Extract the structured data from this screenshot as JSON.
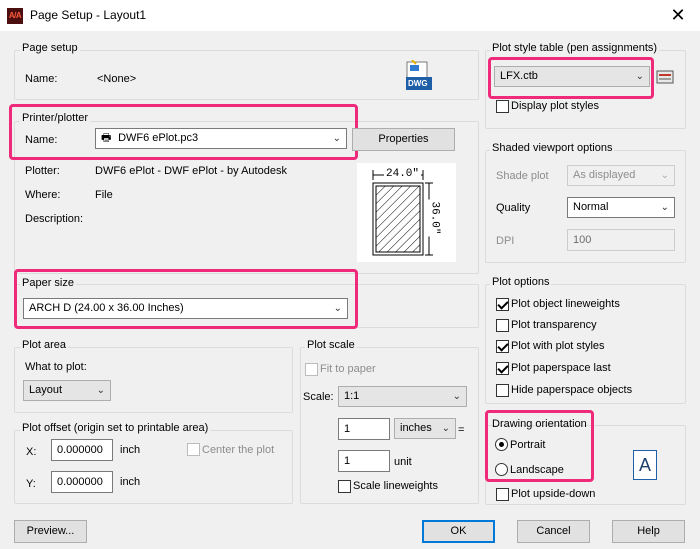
{
  "window": {
    "title": "Page Setup - Layout1",
    "app_icon": "A/A"
  },
  "page_setup": {
    "label": "Page setup",
    "name_label": "Name:",
    "name_value": "<None>",
    "dwg_icon_text": "DWG"
  },
  "printer": {
    "label": "Printer/plotter",
    "name_label": "Name:",
    "name_value": "DWF6 ePlot.pc3",
    "properties_button": "Properties",
    "plotter_label": "Plotter:",
    "plotter_value": "DWF6 ePlot - DWF ePlot - by Autodesk",
    "where_label": "Where:",
    "where_value": "File",
    "description_label": "Description:",
    "preview_width": "24.0″",
    "preview_height": "36.0″"
  },
  "paper_size": {
    "label": "Paper size",
    "value": "ARCH D (24.00 x 36.00 Inches)"
  },
  "plot_area": {
    "label": "Plot area",
    "what_label": "What to plot:",
    "value": "Layout"
  },
  "plot_offset": {
    "label": "Plot offset (origin set to printable area)",
    "x_label": "X:",
    "x_value": "0.000000",
    "x_unit": "inch",
    "y_label": "Y:",
    "y_value": "0.000000",
    "y_unit": "inch",
    "center_label": "Center the plot"
  },
  "plot_scale": {
    "label": "Plot scale",
    "fit_label": "Fit to paper",
    "scale_label": "Scale:",
    "scale_value": "1:1",
    "num1": "1",
    "unit_value": "inches",
    "equals": "=",
    "num2": "1",
    "unit_label": "unit",
    "scale_lw_label": "Scale lineweights"
  },
  "plot_style": {
    "label": "Plot style table (pen assignments)",
    "value": "LFX.ctb",
    "display_label": "Display plot styles"
  },
  "shaded": {
    "label": "Shaded viewport options",
    "shade_label": "Shade plot",
    "shade_value": "As displayed",
    "quality_label": "Quality",
    "quality_value": "Normal",
    "dpi_label": "DPI",
    "dpi_value": "100"
  },
  "plot_options": {
    "label": "Plot options",
    "items": [
      {
        "label": "Plot object lineweights",
        "checked": true
      },
      {
        "label": "Plot transparency",
        "checked": false
      },
      {
        "label": "Plot with plot styles",
        "checked": true
      },
      {
        "label": "Plot paperspace last",
        "checked": true
      },
      {
        "label": "Hide paperspace objects",
        "checked": false
      }
    ]
  },
  "orientation": {
    "label": "Drawing orientation",
    "portrait": "Portrait",
    "landscape": "Landscape",
    "upside_down": "Plot upside-down",
    "icon_text": "A"
  },
  "footer": {
    "preview": "Preview...",
    "ok": "OK",
    "cancel": "Cancel",
    "help": "Help"
  },
  "colors": {
    "highlight": "#ef2a7b",
    "accent": "#0078d7",
    "background": "#f0f0f0"
  }
}
